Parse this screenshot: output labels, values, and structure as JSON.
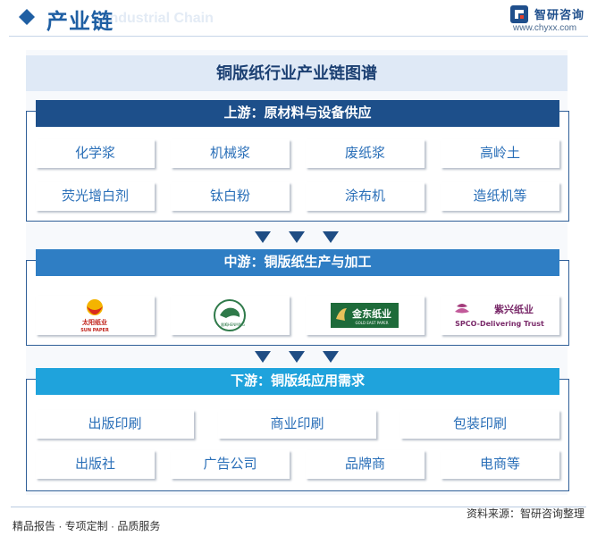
{
  "header": {
    "title": "产业链",
    "watermark": "Industrial Chain",
    "brand_name": "智研咨询",
    "brand_url": "www.chyxx.com"
  },
  "diagram_title": "铜版纸行业产业链图谱",
  "upstream": {
    "label": "上游：原材料与设备供应",
    "items": [
      "化学浆",
      "机械浆",
      "废纸浆",
      "高岭土",
      "荧光增白剂",
      "钛白粉",
      "涂布机",
      "造纸机等"
    ]
  },
  "midstream": {
    "label": "中游：铜版纸生产与加工",
    "companies": [
      {
        "name": "太阳纸业",
        "sub": "SUN PAPER"
      },
      {
        "name": "晨鸣",
        "sub": "CHENMING"
      },
      {
        "name": "金东纸业",
        "sub": "GOLD EAST PAPER"
      },
      {
        "name": "紫兴纸业",
        "sub": "SPCO-Delivering Trust"
      }
    ]
  },
  "downstream": {
    "label": "下游：铜版纸应用需求",
    "row1": [
      "出版印刷",
      "商业印刷",
      "包装印刷"
    ],
    "row2": [
      "出版社",
      "广告公司",
      "品牌商",
      "电商等"
    ]
  },
  "footer": {
    "left": "精品报告 · 专项定制 · 品质服务",
    "right": "资料来源：智研咨询整理"
  },
  "colors": {
    "brand_blue": "#1f5fa3",
    "upstream_bar": "#1d4f8a",
    "midstream_bar": "#2f7ec4",
    "downstream_bar": "#1fa3dc",
    "item_text": "#2a6fb8",
    "arrow": "#1f4d84"
  }
}
